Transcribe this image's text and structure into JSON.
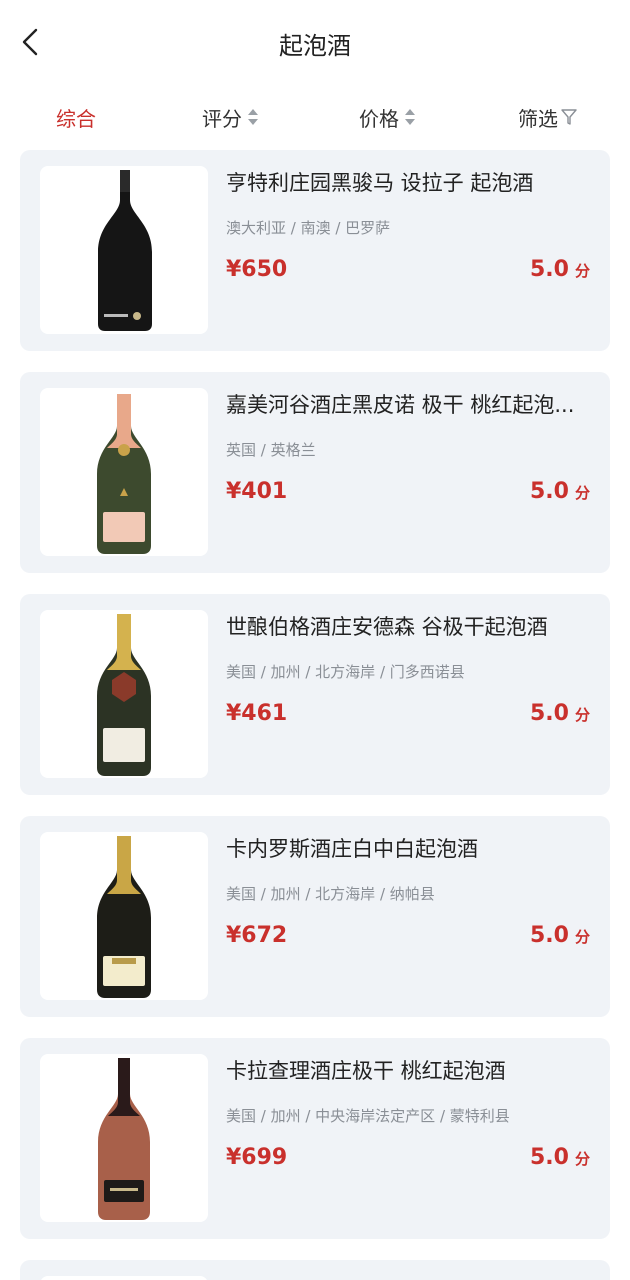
{
  "header": {
    "title": "起泡酒"
  },
  "sortbar": {
    "items": [
      {
        "label": "综合",
        "active": true
      },
      {
        "label": "评分",
        "active": false
      },
      {
        "label": "价格",
        "active": false
      },
      {
        "label": "筛选",
        "active": false
      }
    ]
  },
  "products": [
    {
      "name": "亨特利庄园黑骏马 设拉子 起泡酒",
      "region": "澳大利亚 / 南澳 / 巴罗萨",
      "price": "¥650",
      "score": "5.0",
      "score_unit": "分",
      "image": "red-sparkling-bottle"
    },
    {
      "name": "嘉美河谷酒庄黑皮诺 极干 桃红起泡...",
      "region": "英国 / 英格兰",
      "price": "¥401",
      "score": "5.0",
      "score_unit": "分",
      "image": "rose-sparkling-bottle"
    },
    {
      "name": "世酿伯格酒庄安德森 谷极干起泡酒",
      "region": "美国 / 加州 / 北方海岸 / 门多西诺县",
      "price": "¥461",
      "score": "5.0",
      "score_unit": "分",
      "image": "gold-foil-sparkling-bottle"
    },
    {
      "name": "卡内罗斯酒庄白中白起泡酒",
      "region": "美国 / 加州 / 北方海岸 / 纳帕县",
      "price": "¥672",
      "score": "5.0",
      "score_unit": "分",
      "image": "gold-foil-sparkling-bottle"
    },
    {
      "name": "卡拉查理酒庄极干 桃红起泡酒",
      "region": "美国 / 加州 / 中央海岸法定产区 / 蒙特利县",
      "price": "¥699",
      "score": "5.0",
      "score_unit": "分",
      "image": "rose-sparkling-bottle"
    }
  ],
  "colors": {
    "accent": "#c9302c",
    "card_bg": "#f0f3f7",
    "muted_text": "#8a8f96"
  }
}
